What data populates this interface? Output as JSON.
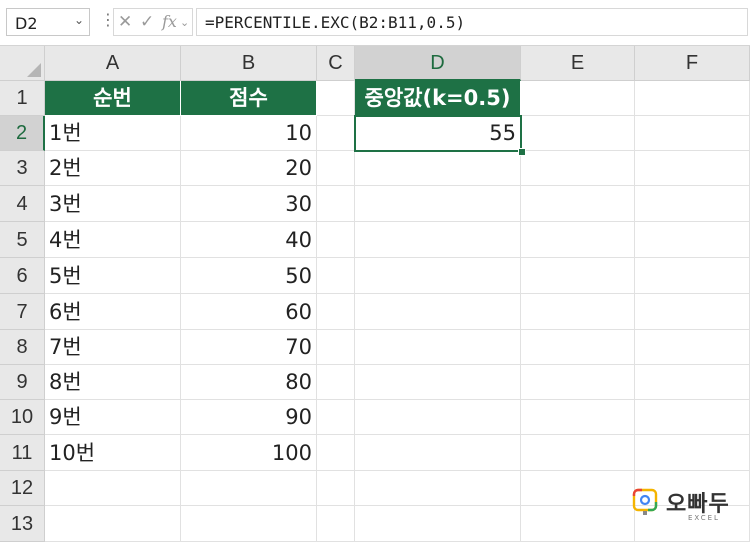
{
  "formula_bar": {
    "name_box": "D2",
    "name_box_dropdown": "⌄",
    "more": "⋮",
    "cancel": "✕",
    "enter": "✓",
    "fx": "fx",
    "fx_dropdown": "⌄",
    "formula": "=PERCENTILE.EXC(B2:B11,0.5)"
  },
  "columns": [
    "A",
    "B",
    "C",
    "D",
    "E",
    "F"
  ],
  "rows": [
    "1",
    "2",
    "3",
    "4",
    "5",
    "6",
    "7",
    "8",
    "9",
    "10",
    "11",
    "12",
    "13"
  ],
  "table": {
    "header_a": "순번",
    "header_b": "점수",
    "items": [
      {
        "label": "1번",
        "score": "10"
      },
      {
        "label": "2번",
        "score": "20"
      },
      {
        "label": "3번",
        "score": "30"
      },
      {
        "label": "4번",
        "score": "40"
      },
      {
        "label": "5번",
        "score": "50"
      },
      {
        "label": "6번",
        "score": "60"
      },
      {
        "label": "7번",
        "score": "70"
      },
      {
        "label": "8번",
        "score": "80"
      },
      {
        "label": "9번",
        "score": "90"
      },
      {
        "label": "10번",
        "score": "100"
      }
    ]
  },
  "result": {
    "header": "중앙값(k=0.5)",
    "value": "55"
  },
  "watermark": {
    "name": "오빠두",
    "sub": "EXCEL"
  },
  "colors": {
    "accent": "#1e7145",
    "header_bg": "#e8e8e8",
    "selected_header_bg": "#d2d2d2"
  }
}
